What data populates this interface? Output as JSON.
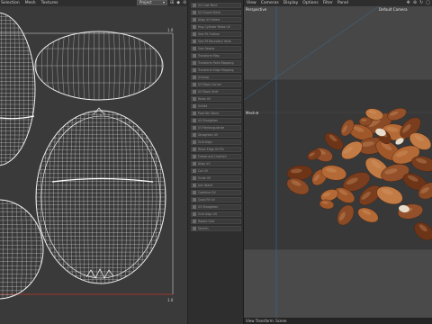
{
  "uv_editor": {
    "menu": [
      "Selection",
      "Mesh",
      "Textures"
    ],
    "dropdown_value": "Project",
    "tool_icons": [
      "grid-icon",
      "tag-icon",
      "link-icon"
    ],
    "tick_top": "1.0",
    "tick_bottom": "1.0"
  },
  "command_panel": {
    "buttons": [
      "UV Cast Point",
      "UV Guard Stitch",
      "Align UV Select",
      "Hug Cylinder Relax UV",
      "Sew Fit Outline",
      "Sew Fit Boundary Verts",
      "Sew Seams",
      "Transform Map",
      "Transform Point Mapping",
      "Transform Edge Mapping",
      "Unwrap",
      "UV Block Corner",
      "UV Block Shift",
      "Relax UV",
      "Unfold",
      "Pack Bin Block",
      "UV Straighten",
      "UV Rectangularize",
      "Straighten UV",
      "Grid Align",
      "Relax Edge UV Pin",
      "Freeze and Unstitch",
      "Align UV",
      "Cut UV",
      "Scale UV",
      "Join Island",
      "Combine UV",
      "Quad Fit UV",
      "UV Straighten",
      "Grid Align UV",
      "Rotate Grid",
      "Stretch"
    ]
  },
  "viewport": {
    "menu": [
      "View",
      "Cameras",
      "Display",
      "Options",
      "Filter",
      "Panel"
    ],
    "tool_icons": [
      "move-icon",
      "zoom-icon",
      "rotate-icon",
      "maximize-icon"
    ],
    "view_name": "Perspective",
    "camera_name": "Default Camera",
    "floor_label": "Mesh",
    "status": "View Transform: Scene"
  }
}
